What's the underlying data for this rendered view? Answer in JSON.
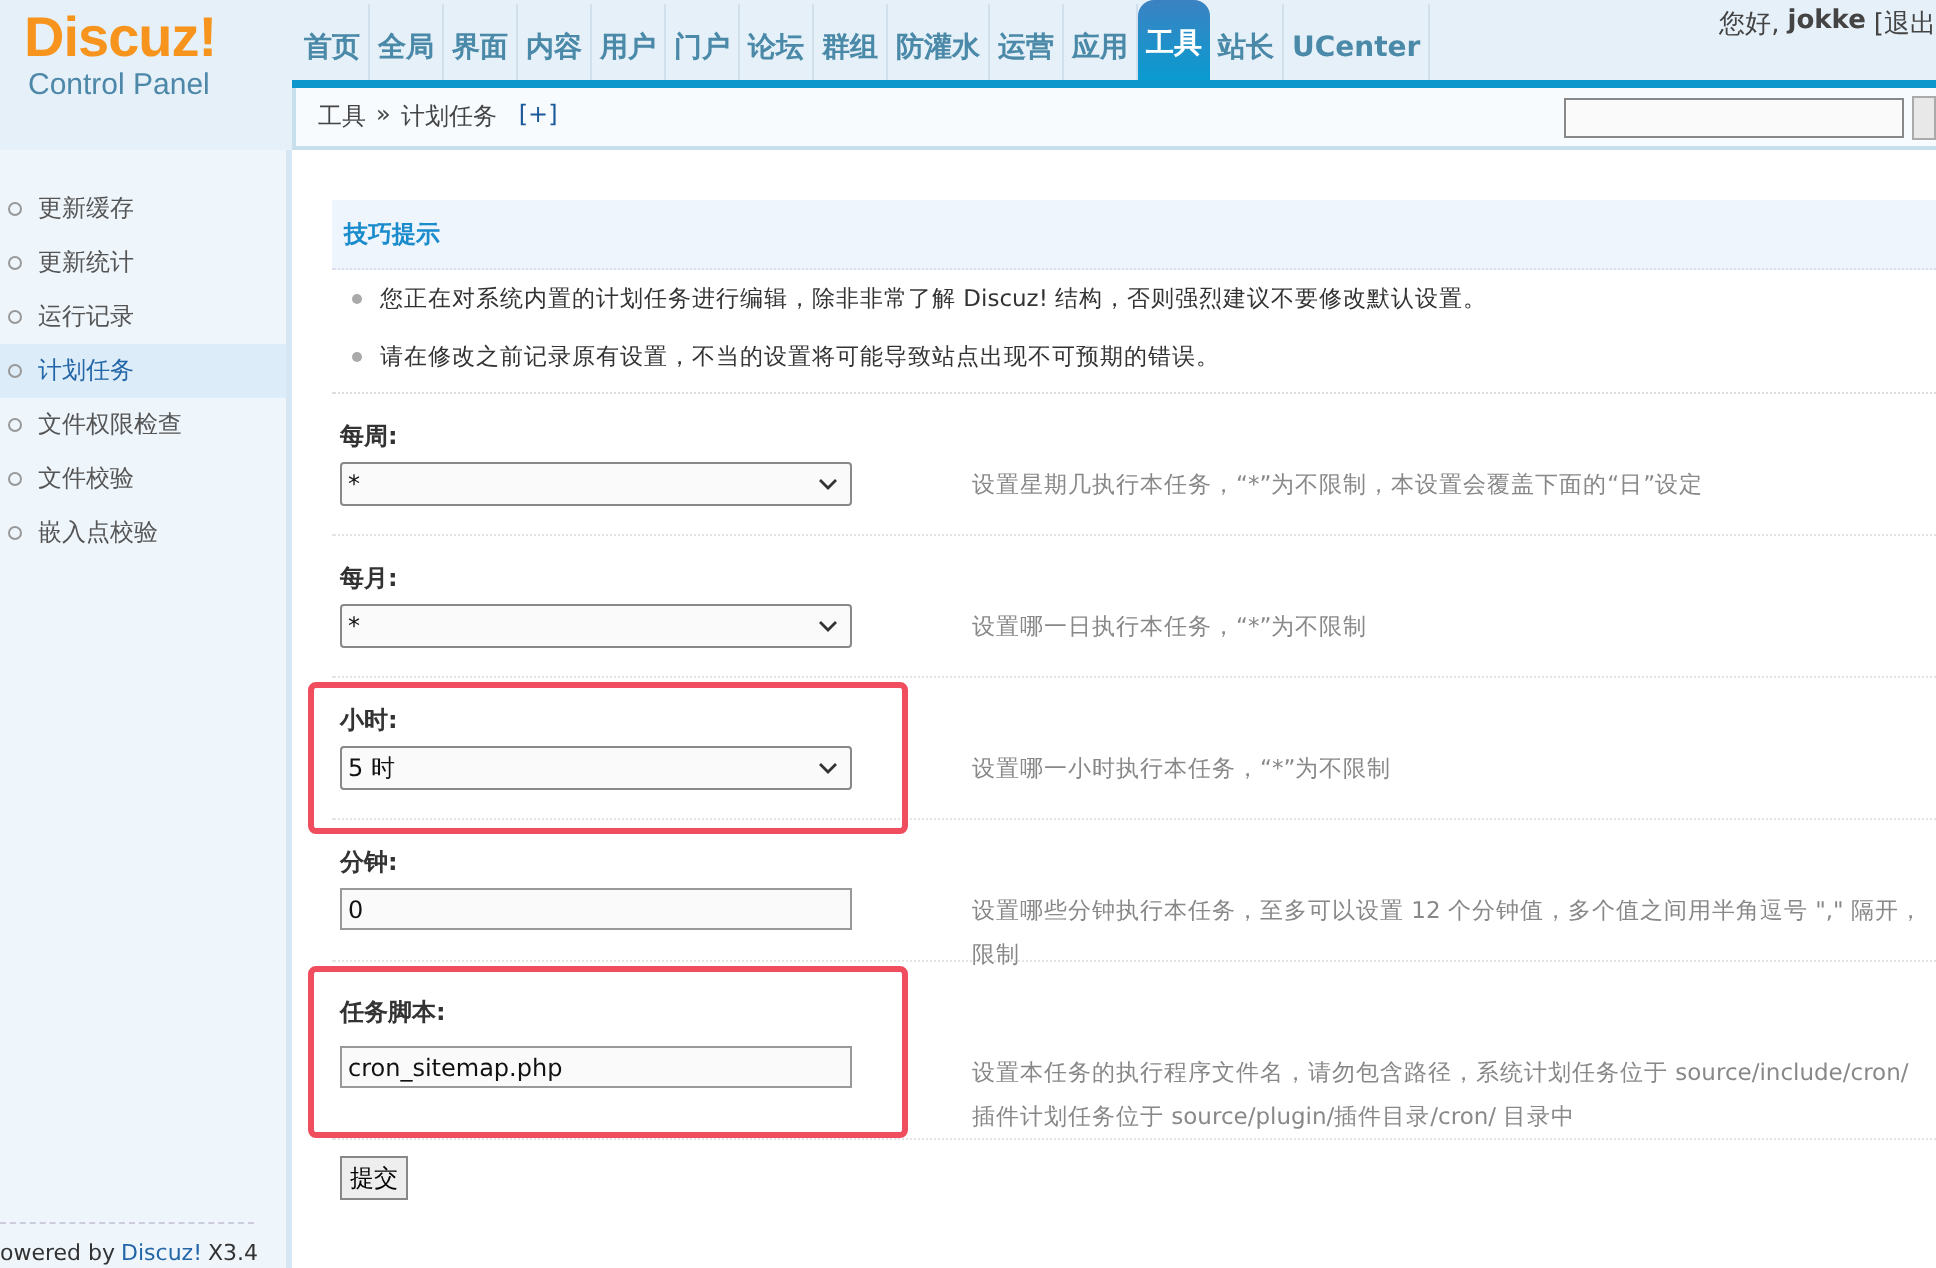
{
  "logo": {
    "name": "Discuz!",
    "subtitle": "Control Panel"
  },
  "nav": [
    {
      "label": "首页",
      "selected": false
    },
    {
      "label": "全局",
      "selected": false
    },
    {
      "label": "界面",
      "selected": false
    },
    {
      "label": "内容",
      "selected": false
    },
    {
      "label": "用户",
      "selected": false
    },
    {
      "label": "门户",
      "selected": false
    },
    {
      "label": "论坛",
      "selected": false
    },
    {
      "label": "群组",
      "selected": false
    },
    {
      "label": "防灌水",
      "selected": false
    },
    {
      "label": "运营",
      "selected": false
    },
    {
      "label": "应用",
      "selected": false
    },
    {
      "label": "工具",
      "selected": true
    },
    {
      "label": "站长",
      "selected": false
    },
    {
      "label": "UCenter",
      "selected": false
    }
  ],
  "user": {
    "greeting": "您好,",
    "name": "jokke",
    "logout": "[退出"
  },
  "breadcrumb": {
    "items": [
      "工具",
      "»",
      "计划任务"
    ],
    "add": "[+]"
  },
  "sidebar": {
    "items": [
      {
        "label": "更新缓存",
        "selected": false
      },
      {
        "label": "更新统计",
        "selected": false
      },
      {
        "label": "运行记录",
        "selected": false
      },
      {
        "label": "计划任务",
        "selected": true
      },
      {
        "label": "文件权限检查",
        "selected": false
      },
      {
        "label": "文件校验",
        "selected": false
      },
      {
        "label": "嵌入点校验",
        "selected": false
      }
    ],
    "footer": {
      "prefix": "owered by",
      "link": "Discuz!",
      "version": "X3.4"
    }
  },
  "tips": {
    "title": "技巧提示",
    "items": [
      "您正在对系统内置的计划任务进行编辑，除非非常了解 Discuz! 结构，否则强烈建议不要修改默认设置。",
      "请在修改之前记录原有设置，不当的设置将可能导致站点出现不可预期的错误。"
    ]
  },
  "form": [
    {
      "label": "每周:",
      "kind": "select",
      "value": "*",
      "highlighted": false,
      "hint": [
        "设置星期几执行本任务，“*”为不限制，本设置会覆盖下面的“日”设定"
      ]
    },
    {
      "label": "每月:",
      "kind": "select",
      "value": "*",
      "highlighted": false,
      "hint": [
        "设置哪一日执行本任务，“*”为不限制"
      ]
    },
    {
      "label": "小时:",
      "kind": "select",
      "value": "5 时",
      "highlighted": true,
      "hint": [
        "设置哪一小时执行本任务，“*”为不限制"
      ]
    },
    {
      "label": "分钟:",
      "kind": "text",
      "value": "0",
      "highlighted": false,
      "hint": [
        "设置哪些分钟执行本任务，至多可以设置 12 个分钟值，多个值之间用半角逗号 \",\" 隔开，",
        "限制"
      ]
    },
    {
      "label": "任务脚本:",
      "kind": "text",
      "value": "cron_sitemap.php",
      "highlighted": true,
      "hint": [
        "设置本任务的执行程序文件名，请勿包含路径，系统计划任务位于 source/include/cron/",
        "插件计划任务位于 source/plugin/插件目录/cron/ 目录中"
      ]
    }
  ],
  "submit": "提交"
}
